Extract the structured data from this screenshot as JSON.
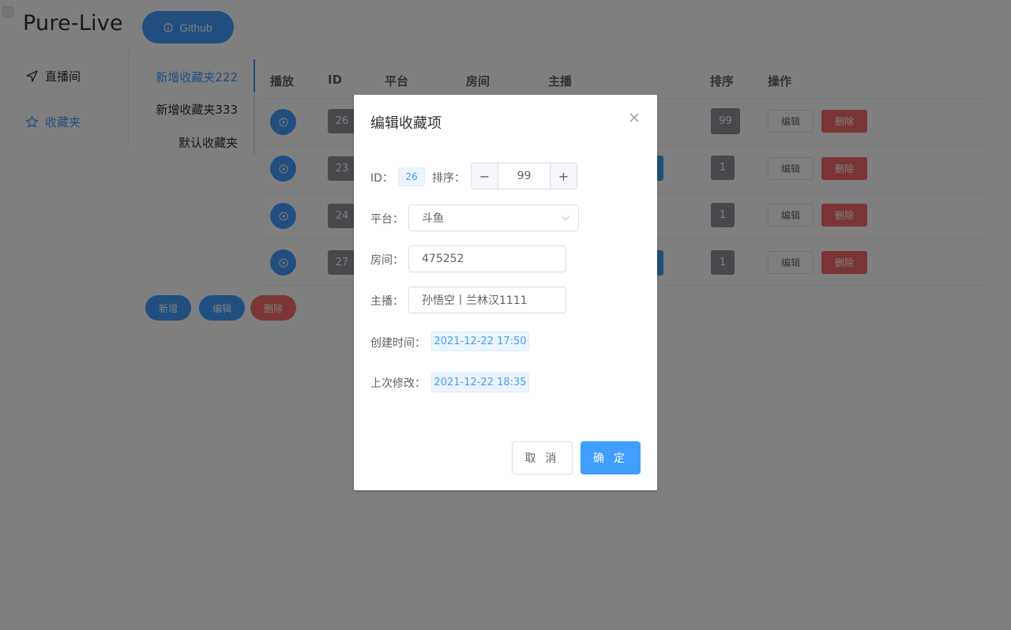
{
  "app": {
    "title": "Pure-Live",
    "github_label": "Github"
  },
  "side_menu": {
    "items": [
      {
        "label": "直播间",
        "icon": "navigation-icon"
      },
      {
        "label": "收藏夹",
        "icon": "star-icon"
      }
    ]
  },
  "folders": [
    {
      "label": "新增收藏夹222"
    },
    {
      "label": "新增收藏夹333"
    },
    {
      "label": "默认收藏夹"
    }
  ],
  "table": {
    "headers": [
      "播放",
      "ID",
      "平台",
      "房间",
      "主播",
      "排序",
      "操作"
    ],
    "rows": [
      {
        "id": "26",
        "sort": "99",
        "edit": "编辑",
        "delete": "删除"
      },
      {
        "id": "23",
        "sort": "1",
        "edit": "编辑",
        "delete": "删除"
      },
      {
        "id": "24",
        "sort": "1",
        "edit": "编辑",
        "delete": "删除"
      },
      {
        "id": "27",
        "sort": "1",
        "edit": "编辑",
        "delete": "删除"
      }
    ]
  },
  "bottom_actions": {
    "add": "新增",
    "edit": "编辑",
    "delete": "删除"
  },
  "dialog": {
    "title": "编辑收藏项",
    "id_label": "ID：",
    "id_value": "26",
    "sort_label": "排序：",
    "sort_minus": "−",
    "sort_value": "99",
    "sort_plus": "+",
    "platform_label": "平台：",
    "platform_value": "斗鱼",
    "room_label": "房间：",
    "room_value": "475252",
    "host_label": "主播：",
    "host_value": "孙悟空丨兰林汉1111",
    "created_label": "创建时间：",
    "created_value": "2021-12-22 17:50",
    "modified_label": "上次修改：",
    "modified_value": "2021-12-22 18:35",
    "cancel": "取 消",
    "confirm": "确 定"
  },
  "colors": {
    "primary": "#409eff",
    "danger": "#f56c6c",
    "info": "#909399"
  }
}
